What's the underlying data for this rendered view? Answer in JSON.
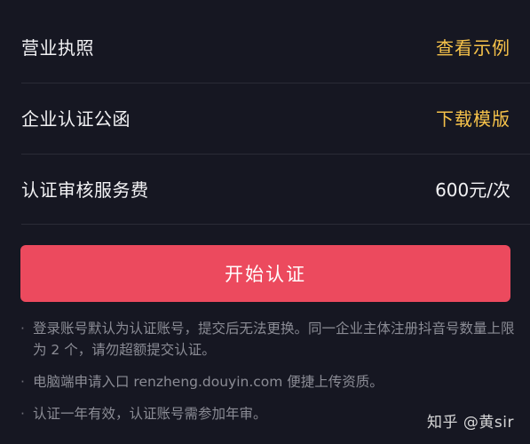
{
  "rows": [
    {
      "label": "营业执照",
      "action": "查看示例"
    },
    {
      "label": "企业认证公函",
      "action": "下载模版"
    },
    {
      "label": "认证审核服务费",
      "value": "600元/次"
    }
  ],
  "cta": {
    "label": "开始认证"
  },
  "notes": [
    {
      "bullet": "·",
      "text": "登录账号默认为认证账号，提交后无法更换。同一企业主体注册抖音号数量上限为 2 个，请勿超额提交认证。"
    },
    {
      "bullet": "·",
      "text": "电脑端申请入口 renzheng.douyin.com 便捷上传资质。"
    },
    {
      "bullet": "·",
      "text": "认证一年有效，认证账号需参加年审。"
    }
  ],
  "watermark": "知乎 @黄sir",
  "colors": {
    "background": "#161722",
    "accent": "#f6c24a",
    "button": "#ec4a5e",
    "note": "#8b8c95"
  }
}
